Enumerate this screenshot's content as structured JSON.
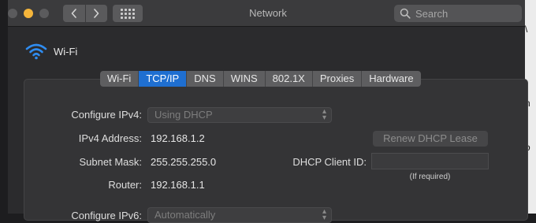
{
  "window": {
    "title": "Network"
  },
  "toolbar": {
    "back_icon": "chevron-left-icon",
    "forward_icon": "chevron-right-icon",
    "grid_icon": "show-all-grid-icon"
  },
  "search": {
    "placeholder": "Search"
  },
  "interface": {
    "name": "Wi-Fi",
    "icon": "wifi-icon"
  },
  "tabs": [
    {
      "label": "Wi-Fi",
      "active": false
    },
    {
      "label": "TCP/IP",
      "active": true
    },
    {
      "label": "DNS",
      "active": false
    },
    {
      "label": "WINS",
      "active": false
    },
    {
      "label": "802.1X",
      "active": false
    },
    {
      "label": "Proxies",
      "active": false
    },
    {
      "label": "Hardware",
      "active": false
    }
  ],
  "tcpip": {
    "configure_ipv4_label": "Configure IPv4:",
    "configure_ipv4_value": "Using DHCP",
    "ipv4_address_label": "IPv4 Address:",
    "ipv4_address_value": "192.168.1.2",
    "subnet_mask_label": "Subnet Mask:",
    "subnet_mask_value": "255.255.255.0",
    "router_label": "Router:",
    "router_value": "192.168.1.1",
    "renew_button": "Renew DHCP Lease",
    "dhcp_client_id_label": "DHCP Client ID:",
    "dhcp_client_id_value": "",
    "dhcp_client_id_hint": "(If required)",
    "configure_ipv6_label": "Configure IPv6:",
    "configure_ipv6_value": "Automatically"
  },
  "colors": {
    "accent": "#1f6fd1",
    "wifi_icon": "#2f8cf0",
    "minimize": "#f5b53b"
  }
}
